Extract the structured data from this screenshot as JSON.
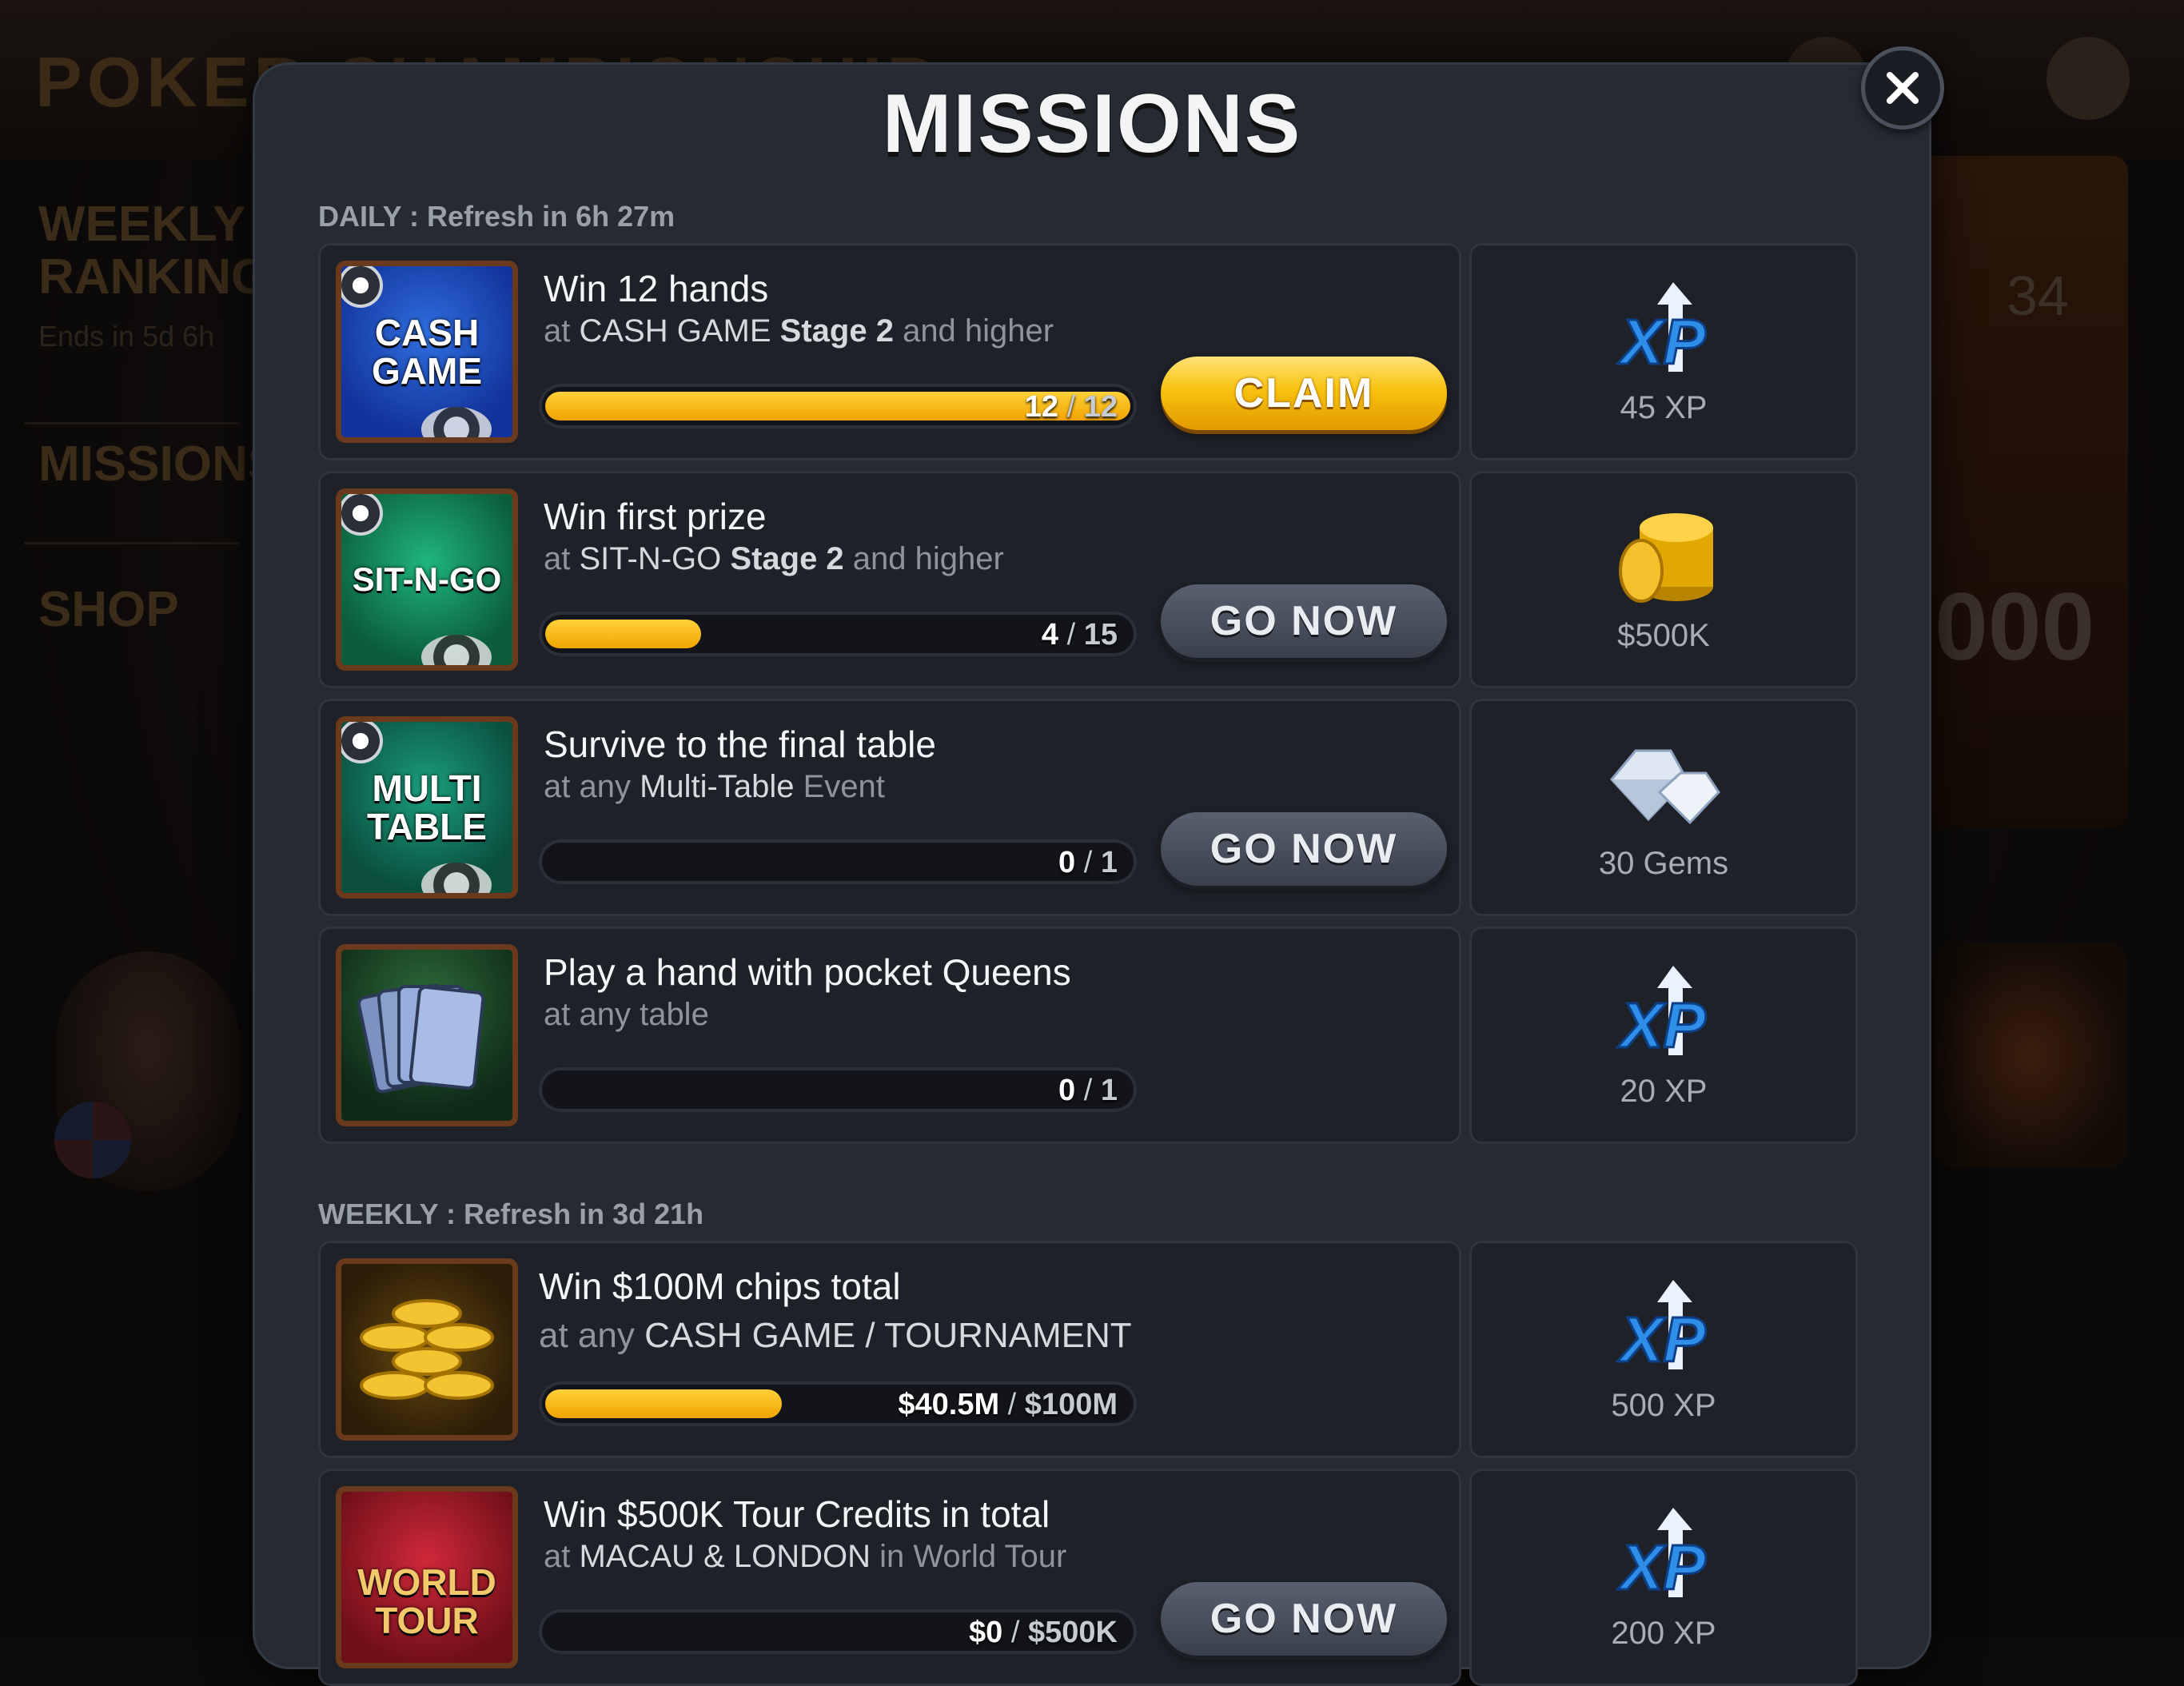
{
  "background": {
    "logo_text": "POKER CHAMPIONSHIP",
    "nav": [
      {
        "label": "WEEKLY RANKINGS",
        "sub": "Ends in 5d 6h"
      },
      {
        "label": "MISSIONS"
      },
      {
        "label": "SHOP"
      }
    ]
  },
  "modal": {
    "title": "MISSIONS",
    "close_icon": "close-icon"
  },
  "daily": {
    "label": "DAILY : Refresh in 6h 27m",
    "missions": [
      {
        "thumb": "CASH GAME",
        "title": "Win 12 hands",
        "sub_prefix": "at ",
        "sub_em1": "CASH GAME",
        "sub_em2": "Stage 2",
        "sub_suffix": " and higher",
        "progress_current": "12",
        "progress_goal": "12",
        "progress_fraction": 1.0,
        "button": "CLAIM",
        "reward_label": "45 XP",
        "reward_icon": "xp-icon"
      },
      {
        "thumb": "SIT-N-GO",
        "title": "Win first prize",
        "sub_prefix": "at ",
        "sub_em1": "SIT-N-GO",
        "sub_em2": "Stage 2",
        "sub_suffix": " and higher",
        "progress_current": "4",
        "progress_goal": "15",
        "progress_fraction": 0.267,
        "button": "GO NOW",
        "reward_label": "$500K",
        "reward_icon": "coins-icon"
      },
      {
        "thumb": "MULTI TABLE",
        "title": "Survive to the final table",
        "sub_prefix": "at any ",
        "sub_em1": "Multi-Table",
        "sub_suffix": " Event",
        "progress_current": "0",
        "progress_goal": "1",
        "progress_fraction": 0,
        "button": "GO NOW",
        "reward_label": "30 Gems",
        "reward_icon": "gems-icon"
      },
      {
        "thumb": "cards",
        "title": "Play a hand with pocket Queens",
        "sub_prefix": "at any table",
        "progress_current": "0",
        "progress_goal": "1",
        "progress_fraction": 0,
        "reward_label": "20 XP",
        "reward_icon": "xp-icon"
      }
    ]
  },
  "weekly": {
    "label": "WEEKLY : Refresh in 3d 21h",
    "missions": [
      {
        "thumb": "coins",
        "title": "Win $100M chips total",
        "sub_prefix": "at any ",
        "sub_em1": "CASH GAME / TOURNAMENT",
        "progress_current": "$40.5M",
        "progress_goal": "$100M",
        "progress_fraction": 0.405,
        "reward_label": "500 XP",
        "reward_icon": "xp-icon"
      },
      {
        "thumb": "WORLD TOUR",
        "title": "Win $500K Tour Credits in total",
        "sub_prefix": "at ",
        "sub_em1": "MACAU & LONDON",
        "sub_suffix": " in World Tour",
        "progress_current": "$0",
        "progress_goal": "$500K",
        "progress_fraction": 0,
        "button": "GO NOW",
        "reward_label": "200 XP",
        "reward_icon": "xp-icon"
      }
    ]
  },
  "colors": {
    "accent_gold": "#f7c20d",
    "modal_bg": "#262a33",
    "xp_blue": "#2f8fe8"
  }
}
